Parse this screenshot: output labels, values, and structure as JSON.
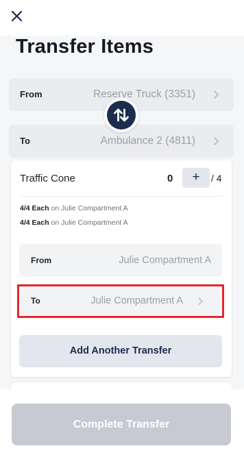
{
  "header": {
    "close_icon": "close-icon",
    "title": "Transfer Items"
  },
  "transfer": {
    "from": {
      "label": "From",
      "value": "Reserve Truck (3351)"
    },
    "to": {
      "label": "To",
      "value": "Ambulance 2 (4811)"
    },
    "swap_icon": "swap-vertical-icon"
  },
  "item": {
    "name": "Traffic Cone",
    "quantity": "0",
    "add_label": "+",
    "total": "/ 4",
    "allocations": [
      {
        "amount": "4/4 Each",
        "text": " on Julie Compartment A"
      },
      {
        "amount": "4/4 Each",
        "text": " on Julie Compartment A"
      }
    ],
    "from": {
      "label": "From",
      "value": "Julie Compartment A"
    },
    "to": {
      "label": "To",
      "value": "Julie Compartment A"
    },
    "add_another_label": "Add Another Transfer"
  },
  "footer": {
    "complete_label": "Complete Transfer"
  },
  "colors": {
    "accent": "#1b2c4d",
    "highlight": "#e3262b",
    "disabled": "#c7cad1"
  }
}
